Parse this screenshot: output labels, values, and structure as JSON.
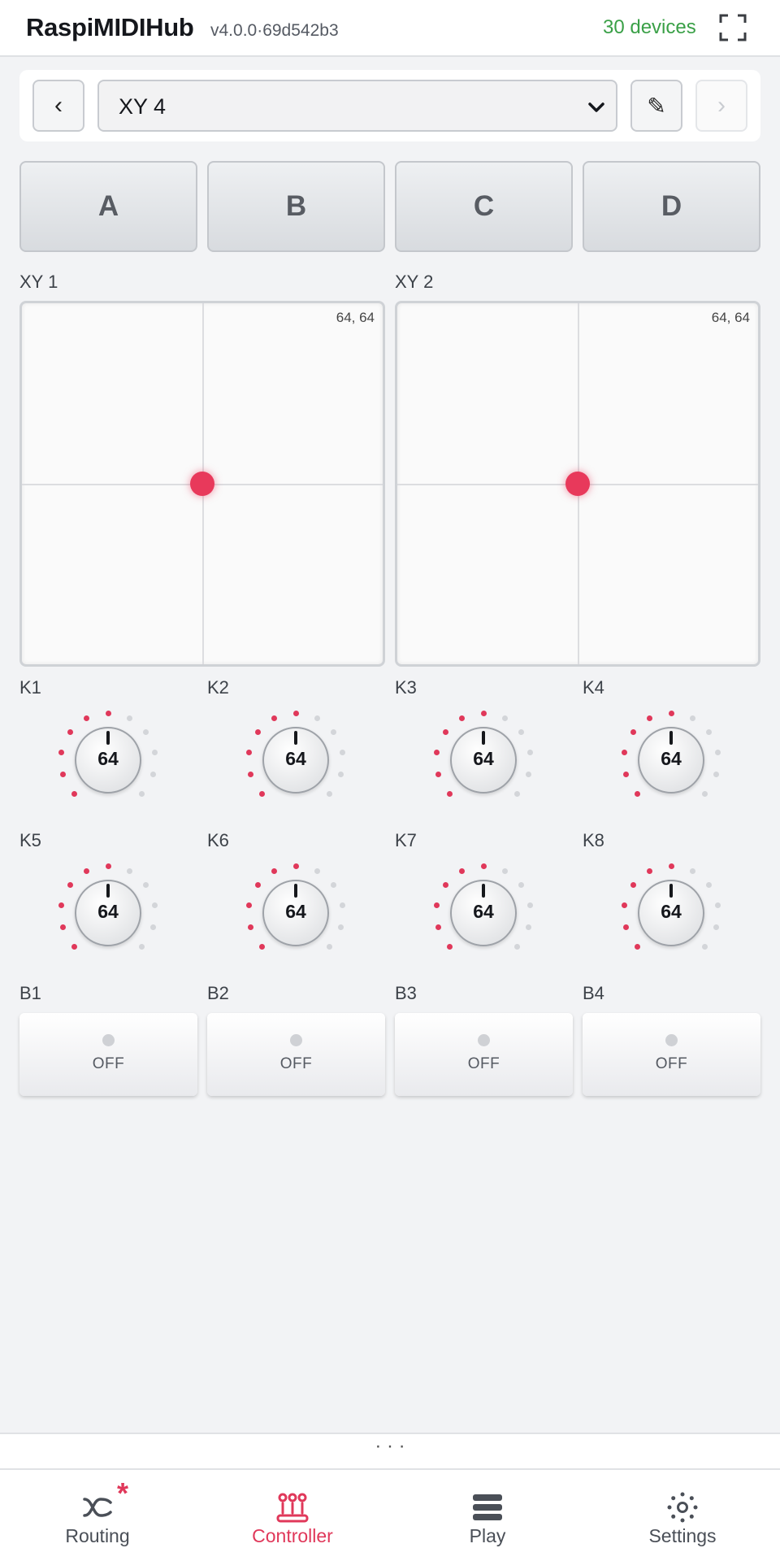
{
  "header": {
    "title": "RaspiMIDIHub",
    "version": "v4.0.0·69d542b3",
    "devices": "30 devices",
    "fullscreen_icon": "fullscreen-icon"
  },
  "preset": {
    "prev_label": "‹",
    "selected": "XY 4",
    "edit_label": "✎",
    "next_label": "›"
  },
  "banks": [
    "A",
    "B",
    "C",
    "D"
  ],
  "xy_pads": [
    {
      "label": "XY 1",
      "value": "64, 64",
      "x": 64,
      "y": 64
    },
    {
      "label": "XY 2",
      "value": "64, 64",
      "x": 64,
      "y": 64
    }
  ],
  "knobs": [
    {
      "label": "K1",
      "value": "64"
    },
    {
      "label": "K2",
      "value": "64"
    },
    {
      "label": "K3",
      "value": "64"
    },
    {
      "label": "K4",
      "value": "64"
    },
    {
      "label": "K5",
      "value": "64"
    },
    {
      "label": "K6",
      "value": "64"
    },
    {
      "label": "K7",
      "value": "64"
    },
    {
      "label": "K8",
      "value": "64"
    }
  ],
  "buttons": [
    {
      "label": "B1",
      "state": "OFF"
    },
    {
      "label": "B2",
      "state": "OFF"
    },
    {
      "label": "B3",
      "state": "OFF"
    },
    {
      "label": "B4",
      "state": "OFF"
    }
  ],
  "drawer": {
    "handle": "· · ·"
  },
  "nav": {
    "routing": "Routing",
    "routing_badge": "*",
    "controller": "Controller",
    "play": "Play",
    "settings": "Settings"
  },
  "colors": {
    "accent": "#e0385a",
    "devices_ok": "#3aa047",
    "knob_tick_active": "#e0385a",
    "knob_tick_inactive": "#d3d5d9"
  }
}
